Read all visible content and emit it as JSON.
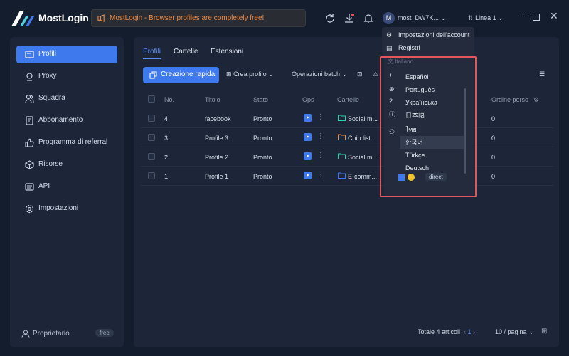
{
  "app": {
    "title": "MostLogin",
    "promo_text": "MostLogin - Browser profiles are completely free!",
    "user_initial": "M",
    "user_name": "most_DW7K...",
    "line_label": "Linea 1"
  },
  "sidebar": {
    "items": [
      {
        "label": "Profili",
        "icon": "profile-card-icon",
        "active": true
      },
      {
        "label": "Proxy",
        "icon": "proxy-icon"
      },
      {
        "label": "Squadra",
        "icon": "team-icon"
      },
      {
        "label": "Abbonamento",
        "icon": "subscription-icon"
      },
      {
        "label": "Programma di referral",
        "icon": "thumbs-up-icon"
      },
      {
        "label": "Risorse",
        "icon": "cube-icon"
      },
      {
        "label": "API",
        "icon": "api-icon"
      },
      {
        "label": "Impostazioni",
        "icon": "gear-icon"
      }
    ],
    "owner_label": "Proprietario",
    "owner_badge": "free"
  },
  "main": {
    "tabs": [
      "Profili",
      "Cartelle",
      "Estensioni"
    ],
    "toolbar": {
      "quick_create": "Creazione rapida",
      "create_profile": "Crea profilo",
      "batch_ops": "Operazioni batch"
    },
    "columns": [
      "No.",
      "Titolo",
      "Stato",
      "Ops",
      "Cartelle",
      "Ordine perso"
    ],
    "rows": [
      {
        "no": "4",
        "title": "facebook",
        "status": "Pronto",
        "folder": "Social m...",
        "order": "0"
      },
      {
        "no": "3",
        "title": "Profile 3",
        "status": "Pronto",
        "folder": "Coin list",
        "order": "0"
      },
      {
        "no": "2",
        "title": "Profile 2",
        "status": "Pronto",
        "folder": "Social m...",
        "order": "0"
      },
      {
        "no": "1",
        "title": "Profile 1",
        "status": "Pronto",
        "folder": "E-comm...",
        "order": "0"
      }
    ],
    "proxy_tag": "direct",
    "footer": {
      "total": "Totale 4 articoli",
      "page": "1",
      "page_size": "10 / pagina"
    }
  },
  "account_menu": {
    "items": [
      "Impostazioni dell'account",
      "Registri"
    ]
  },
  "language_menu": {
    "select_value": "Italiano",
    "options": [
      "Español",
      "Português",
      "Українська",
      "日本語",
      "ไทย",
      "한국어",
      "Türkçe",
      "Deutsch"
    ],
    "hovered": "한국어"
  },
  "colors": {
    "accent": "#3f79ee",
    "promo": "#ee8a42",
    "highlight": "#e0575e"
  }
}
